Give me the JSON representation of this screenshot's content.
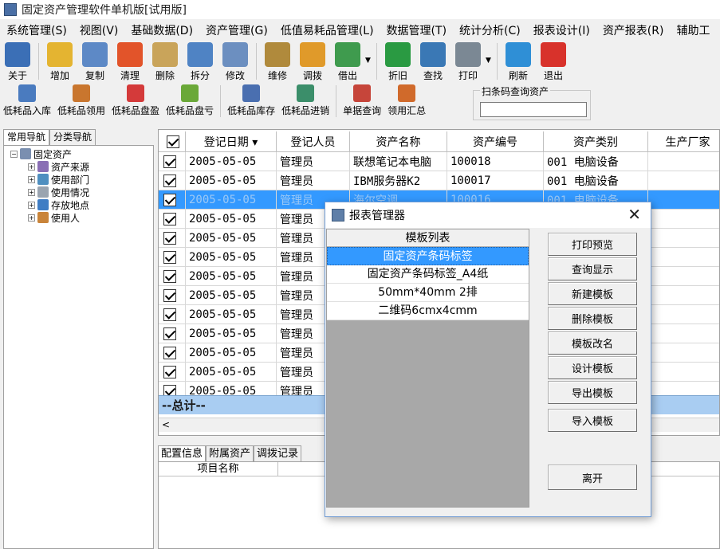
{
  "window": {
    "title": "固定资产管理软件单机版[试用版]"
  },
  "menu": [
    "系统管理(S)",
    "视图(V)",
    "基础数据(D)",
    "资产管理(G)",
    "低值易耗品管理(L)",
    "数据管理(T)",
    "统计分析(C)",
    "报表设计(I)",
    "资产报表(R)",
    "辅助工"
  ],
  "toolbar": [
    {
      "label": "关于",
      "icon": "person-about-icon",
      "color": "#3b6fb6"
    },
    {
      "label": "增加",
      "icon": "folder-add-icon",
      "color": "#e4b431"
    },
    {
      "label": "复制",
      "icon": "copy-pages-icon",
      "color": "#5d89c6"
    },
    {
      "label": "清理",
      "icon": "fire-icon",
      "color": "#e2542a"
    },
    {
      "label": "删除",
      "icon": "delete-edit-icon",
      "color": "#c9a45a"
    },
    {
      "label": "拆分",
      "icon": "window-split-icon",
      "color": "#4f83c4"
    },
    {
      "label": "修改",
      "icon": "pencil-edit-icon",
      "color": "#6c8fc0"
    },
    {
      "label": "维修",
      "icon": "repair-book-icon",
      "color": "#b08a3c"
    },
    {
      "label": "调拨",
      "icon": "transfer-arrow-icon",
      "color": "#e09a2a"
    },
    {
      "label": "借出",
      "icon": "bar-chart-icon",
      "color": "#3f9b4e"
    },
    {
      "label": "折旧",
      "icon": "dollar-icon",
      "color": "#2a9a42"
    },
    {
      "label": "查找",
      "icon": "find-person-icon",
      "color": "#3a78b5"
    },
    {
      "label": "打印",
      "icon": "printer-icon",
      "color": "#7b8894"
    },
    {
      "label": "刷新",
      "icon": "refresh-icon",
      "color": "#2f8fd6"
    },
    {
      "label": "退出",
      "icon": "power-icon",
      "color": "#d8322b"
    }
  ],
  "toolbar2": [
    {
      "label": "低耗品入库",
      "icon": "lc-stock-in-icon",
      "color": "#4a7bbf"
    },
    {
      "label": "低耗品领用",
      "icon": "lc-receive-icon",
      "color": "#c9762e"
    },
    {
      "label": "低耗品盘盈",
      "icon": "lc-surplus-icon",
      "color": "#d43a3a"
    },
    {
      "label": "低耗品盘亏",
      "icon": "lc-loss-icon",
      "color": "#6aa838"
    },
    {
      "label": "低耗品库存",
      "icon": "lc-inventory-icon",
      "color": "#4a6fb0"
    },
    {
      "label": "低耗品进销",
      "icon": "lc-flow-icon",
      "color": "#3b8e6a"
    },
    {
      "label": "单据查询",
      "icon": "doc-query-icon",
      "color": "#c6453a"
    },
    {
      "label": "领用汇总",
      "icon": "receive-summary-icon",
      "color": "#d06a2b"
    }
  ],
  "barcode": {
    "legend": "扫条码查询资产",
    "value": ""
  },
  "left_tabs": [
    "常用导航",
    "分类导航"
  ],
  "tree": {
    "root": "固定资产",
    "children": [
      "资产来源",
      "使用部门",
      "使用情况",
      "存放地点",
      "使用人"
    ]
  },
  "grid": {
    "columns": [
      "",
      "登记日期 ▾",
      "登记人员",
      "资产名称",
      "资产编号",
      "资产类别",
      "生产厂家"
    ],
    "rows": [
      [
        "2005-05-05",
        "管理员",
        "联想笔记本电脑",
        "100018",
        "001 电脑设备"
      ],
      [
        "2005-05-05",
        "管理员",
        "IBM服务器K2",
        "100017",
        "001 电脑设备"
      ],
      [
        "2005-05-05",
        "管理员",
        "海尔空调",
        "100016",
        "001 电脑设备"
      ],
      [
        "2005-05-05",
        "管理员",
        "",
        "",
        ""
      ],
      [
        "2005-05-05",
        "管理员",
        "",
        "",
        ""
      ],
      [
        "2005-05-05",
        "管理员",
        "",
        "",
        ""
      ],
      [
        "2005-05-05",
        "管理员",
        "",
        "",
        ""
      ],
      [
        "2005-05-05",
        "管理员",
        "",
        "",
        ""
      ],
      [
        "2005-05-05",
        "管理员",
        "",
        "",
        ""
      ],
      [
        "2005-05-05",
        "管理员",
        "",
        "",
        ""
      ],
      [
        "2005-05-05",
        "管理员",
        "",
        "",
        ""
      ],
      [
        "2005-05-05",
        "管理员",
        "",
        "",
        ""
      ],
      [
        "2005-05-05",
        "管理员",
        "",
        "",
        ""
      ]
    ],
    "selected_row": 2,
    "total_label": "--总计--"
  },
  "bottom_tabs": [
    "配置信息",
    "附属资产",
    "调拨记录"
  ],
  "bottom_header": "项目名称",
  "dialog": {
    "title": "报表管理器",
    "list_header": "模板列表",
    "templates": [
      "固定资产条码标签",
      "固定资产条码标签_A4纸",
      "50mm*40mm 2排",
      "二维码6cmx4cmm"
    ],
    "selected": 0,
    "buttons": [
      "打印预览",
      "查询显示",
      "新建模板",
      "删除模板",
      "模板改名",
      "设计模板",
      "导出模板",
      "导入模板"
    ],
    "exit": "离开",
    "close": "✕"
  }
}
